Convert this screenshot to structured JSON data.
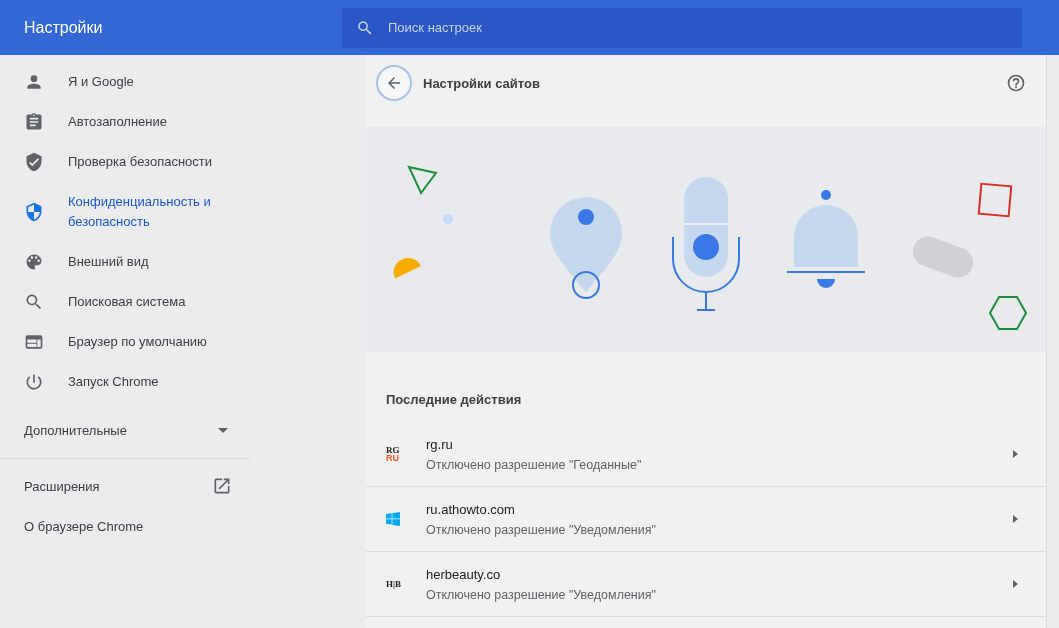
{
  "header": {
    "title": "Настройки",
    "search": {
      "placeholder": "Поиск настроек"
    }
  },
  "sidebar": {
    "items": [
      {
        "label": "Я и Google",
        "kind": "person",
        "selected": false
      },
      {
        "label": "Автозаполнение",
        "kind": "clipboard",
        "selected": false
      },
      {
        "label": "Проверка безопасности",
        "kind": "shield-check",
        "selected": false
      },
      {
        "label": "Конфиденциальность и безопасность",
        "kind": "shield-half",
        "selected": true
      },
      {
        "label": "Внешний вид",
        "kind": "palette",
        "selected": false
      },
      {
        "label": "Поисковая система",
        "kind": "search",
        "selected": false
      },
      {
        "label": "Браузер по умолчанию",
        "kind": "browser",
        "selected": false
      },
      {
        "label": "Запуск Chrome",
        "kind": "power",
        "selected": false
      }
    ],
    "advanced": {
      "label": "Дополнительные",
      "expanded": false
    },
    "links": [
      {
        "label": "Расширения",
        "external": true
      },
      {
        "label": "О браузере Chrome",
        "external": false
      }
    ]
  },
  "page": {
    "title": "Настройки сайтов",
    "section_title": "Последние действия",
    "recent": [
      {
        "site": "rg.ru",
        "detail": "Отключено разрешение \"Геоданные\"",
        "favicon": {
          "kind": "letters",
          "lines": [
            "RG",
            "RU"
          ]
        }
      },
      {
        "site": "ru.athowto.com",
        "detail": "Отключено разрешение \"Уведомления\"",
        "favicon": {
          "kind": "windows"
        }
      },
      {
        "site": "herbeauty.co",
        "detail": "Отключено разрешение \"Уведомления\"",
        "favicon": {
          "kind": "letters",
          "lines": [
            "H|B"
          ]
        }
      }
    ]
  }
}
